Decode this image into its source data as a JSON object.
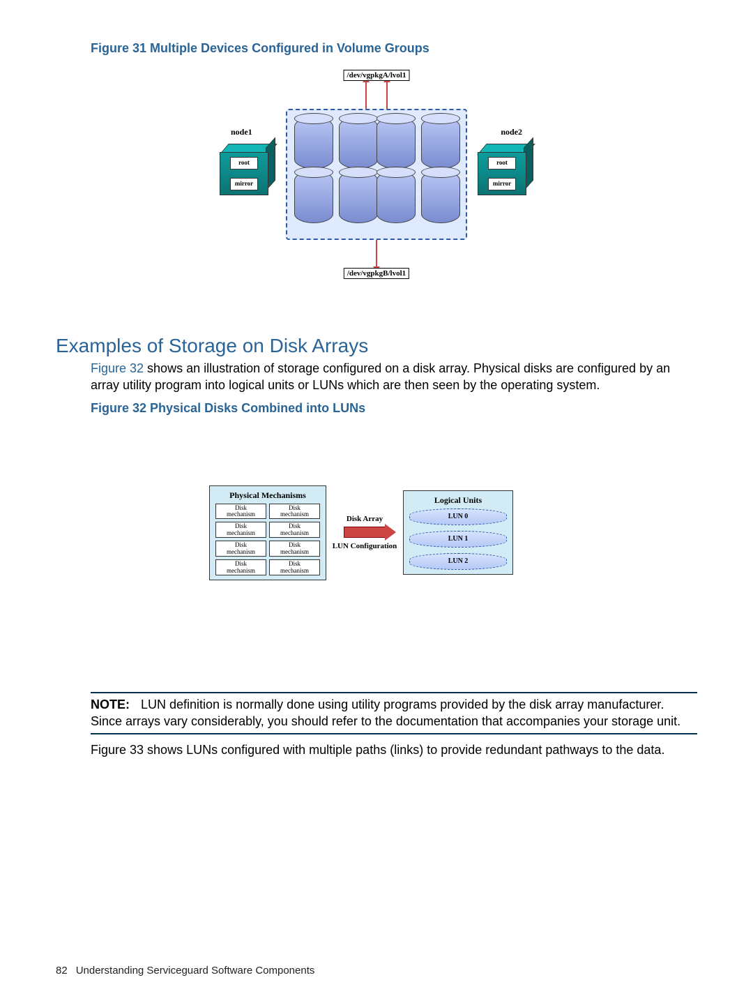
{
  "fig31_caption": "Figure 31 Multiple Devices Configured in Volume Groups",
  "fig31": {
    "lvol_top": "/dev/vgpkgA/lvol1",
    "lvol_bot": "/dev/vgpkgB/lvol1",
    "node1": "node1",
    "node2": "node2",
    "root": "root",
    "mirror": "mirror"
  },
  "section_title": "Examples of Storage on Disk Arrays",
  "intro_para_figref": "Figure 32",
  "intro_para_rest": " shows an illustration of storage configured on a disk array. Physical disks are configured by an array utility program into logical units or LUNs which are then seen by the operating system.",
  "fig32_caption": "Figure 32 Physical Disks Combined into LUNs",
  "fig32": {
    "left_header": "Physical Mechanisms",
    "right_header": "Logical Units",
    "mech_label": "Disk mechanism",
    "mech_count": 8,
    "disk_array": "Disk Array",
    "lun_config": "LUN Configuration",
    "luns": [
      "LUN 0",
      "LUN 1",
      "LUN 2"
    ]
  },
  "note_label": "NOTE:",
  "note_body": "LUN definition is normally done using utility programs provided by the disk array manufacturer. Since arrays vary considerably, you should refer to the documentation that accompanies your storage unit.",
  "after_note_figref": "Figure 33",
  "after_note_rest": " shows LUNs configured with multiple paths (links) to provide redundant pathways to the data.",
  "footer_page": "82",
  "footer_text": "Understanding Serviceguard Software Components"
}
